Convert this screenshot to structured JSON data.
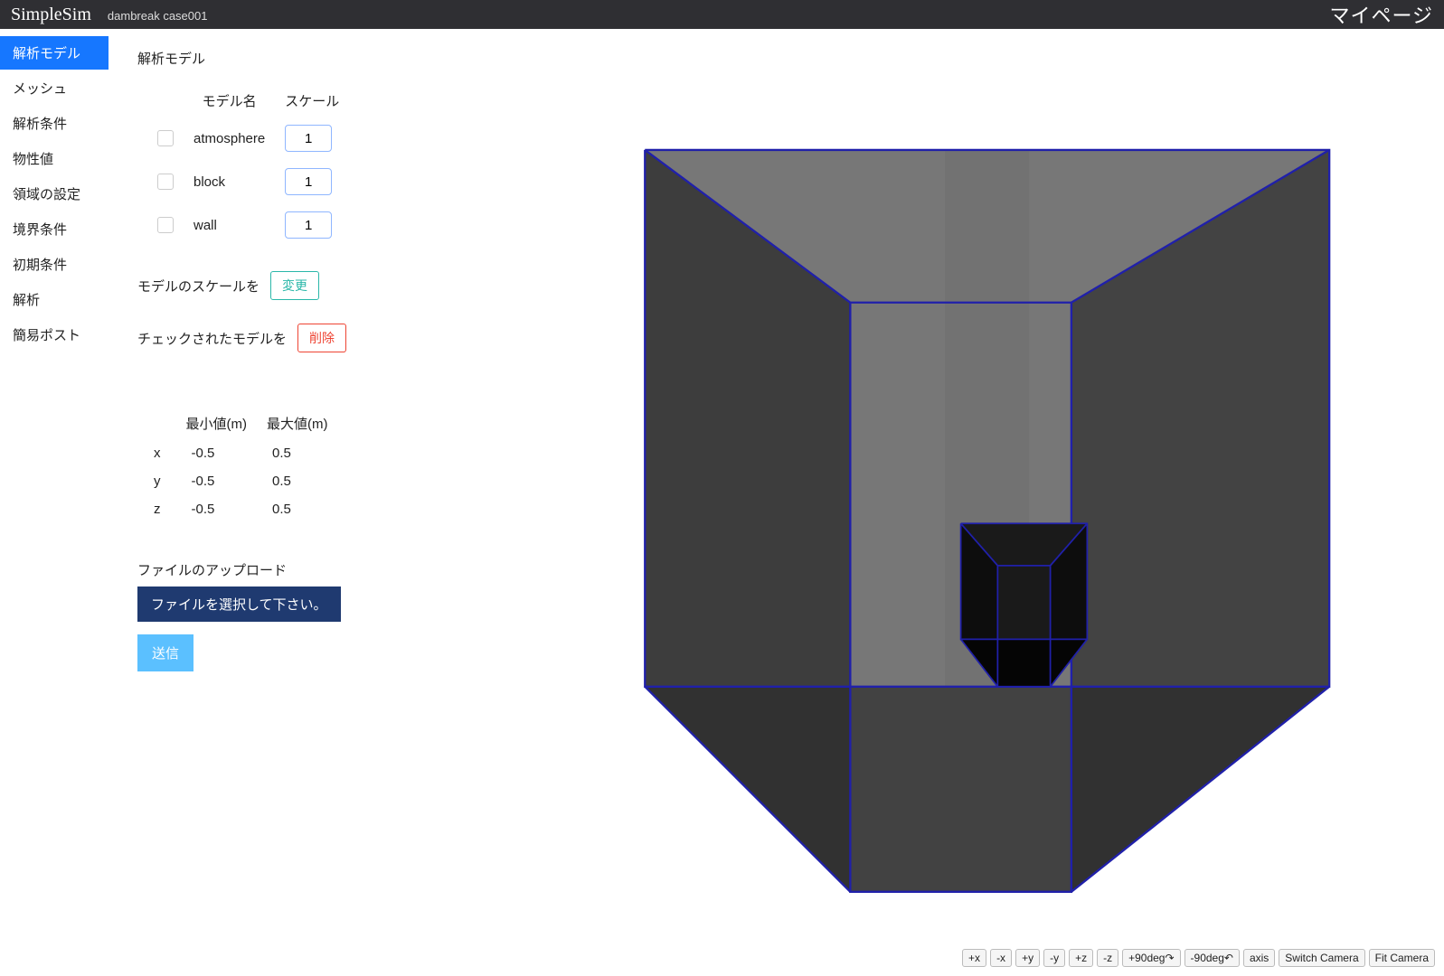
{
  "header": {
    "brand": "SimpleSim",
    "case": "dambreak case001",
    "mypage": "マイページ"
  },
  "sidebar": {
    "items": [
      {
        "label": "解析モデル",
        "active": true
      },
      {
        "label": "メッシュ",
        "active": false
      },
      {
        "label": "解析条件",
        "active": false
      },
      {
        "label": "物性値",
        "active": false
      },
      {
        "label": "領域の設定",
        "active": false
      },
      {
        "label": "境界条件",
        "active": false
      },
      {
        "label": "初期条件",
        "active": false
      },
      {
        "label": "解析",
        "active": false
      },
      {
        "label": "簡易ポスト",
        "active": false
      }
    ]
  },
  "panel": {
    "title": "解析モデル",
    "model_header_name": "モデル名",
    "model_header_scale": "スケール",
    "models": [
      {
        "name": "atmosphere",
        "scale": "1"
      },
      {
        "name": "block",
        "scale": "1"
      },
      {
        "name": "wall",
        "scale": "1"
      }
    ],
    "scale_action_label": "モデルのスケールを",
    "scale_action_button": "変更",
    "delete_action_label": "チェックされたモデルを",
    "delete_action_button": "削除",
    "bounds_header_min": "最小値(m)",
    "bounds_header_max": "最大値(m)",
    "bounds": [
      {
        "axis": "x",
        "min": "-0.5",
        "max": "0.5"
      },
      {
        "axis": "y",
        "min": "-0.5",
        "max": "0.5"
      },
      {
        "axis": "z",
        "min": "-0.5",
        "max": "0.5"
      }
    ],
    "upload_label": "ファイルのアップロード",
    "file_button": "ファイルを選択して下さい。",
    "submit_button": "送信"
  },
  "camera_buttons": [
    "+x",
    "-x",
    "+y",
    "-y",
    "+z",
    "-z",
    "+90deg↷",
    "-90deg↶",
    "axis",
    "Switch Camera",
    "Fit Camera"
  ]
}
